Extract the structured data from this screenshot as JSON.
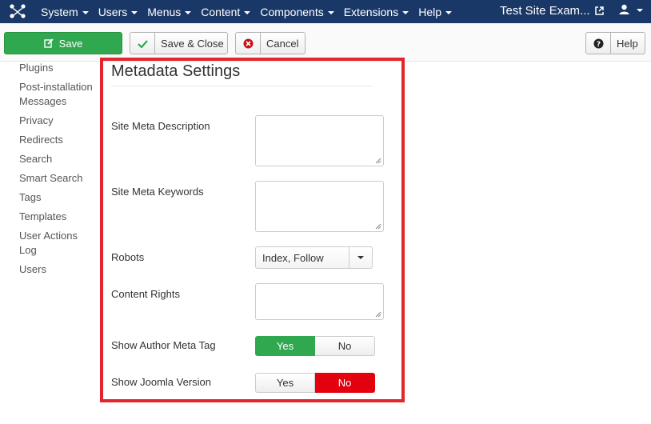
{
  "nav": {
    "menus": [
      "System",
      "Users",
      "Menus",
      "Content",
      "Components",
      "Extensions",
      "Help"
    ],
    "site_title": "Test Site Exam..."
  },
  "toolbar": {
    "save_label": "Save",
    "save_close_label": "Save & Close",
    "cancel_label": "Cancel",
    "help_label": "Help"
  },
  "sidebar": {
    "items": [
      "Plugins",
      "Post-installation Messages",
      "Privacy",
      "Redirects",
      "Search",
      "Smart Search",
      "Tags",
      "Templates",
      "User Actions Log",
      "Users"
    ]
  },
  "panel": {
    "title": "Metadata Settings",
    "fields": {
      "meta_description": {
        "label": "Site Meta Description",
        "value": ""
      },
      "meta_keywords": {
        "label": "Site Meta Keywords",
        "value": ""
      },
      "robots": {
        "label": "Robots",
        "value": "Index, Follow"
      },
      "content_rights": {
        "label": "Content Rights",
        "value": ""
      },
      "author_meta": {
        "label": "Show Author Meta Tag",
        "yes": "Yes",
        "no": "No",
        "selected": "Yes"
      },
      "joomla_version": {
        "label": "Show Joomla Version",
        "yes": "Yes",
        "no": "No",
        "selected": "No"
      }
    }
  },
  "colors": {
    "navbar": "#1a3867",
    "save_green": "#2fa84f",
    "toggle_red": "#e3000f",
    "highlight_red": "#e2262b"
  }
}
